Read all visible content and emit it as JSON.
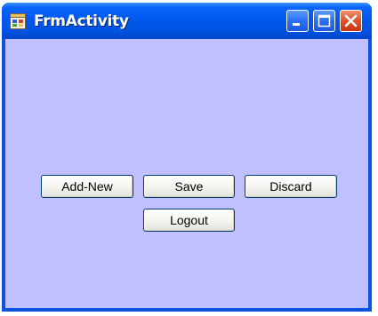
{
  "window": {
    "title": "FrmActivity",
    "controls": {
      "minimize_icon": "minimize-icon",
      "maximize_icon": "maximize-icon",
      "close_icon": "close-icon"
    }
  },
  "form": {
    "background_color": "#c0c0ff",
    "buttons": {
      "add_new": "Add-New",
      "save": "Save",
      "discard": "Discard",
      "logout": "Logout"
    }
  }
}
